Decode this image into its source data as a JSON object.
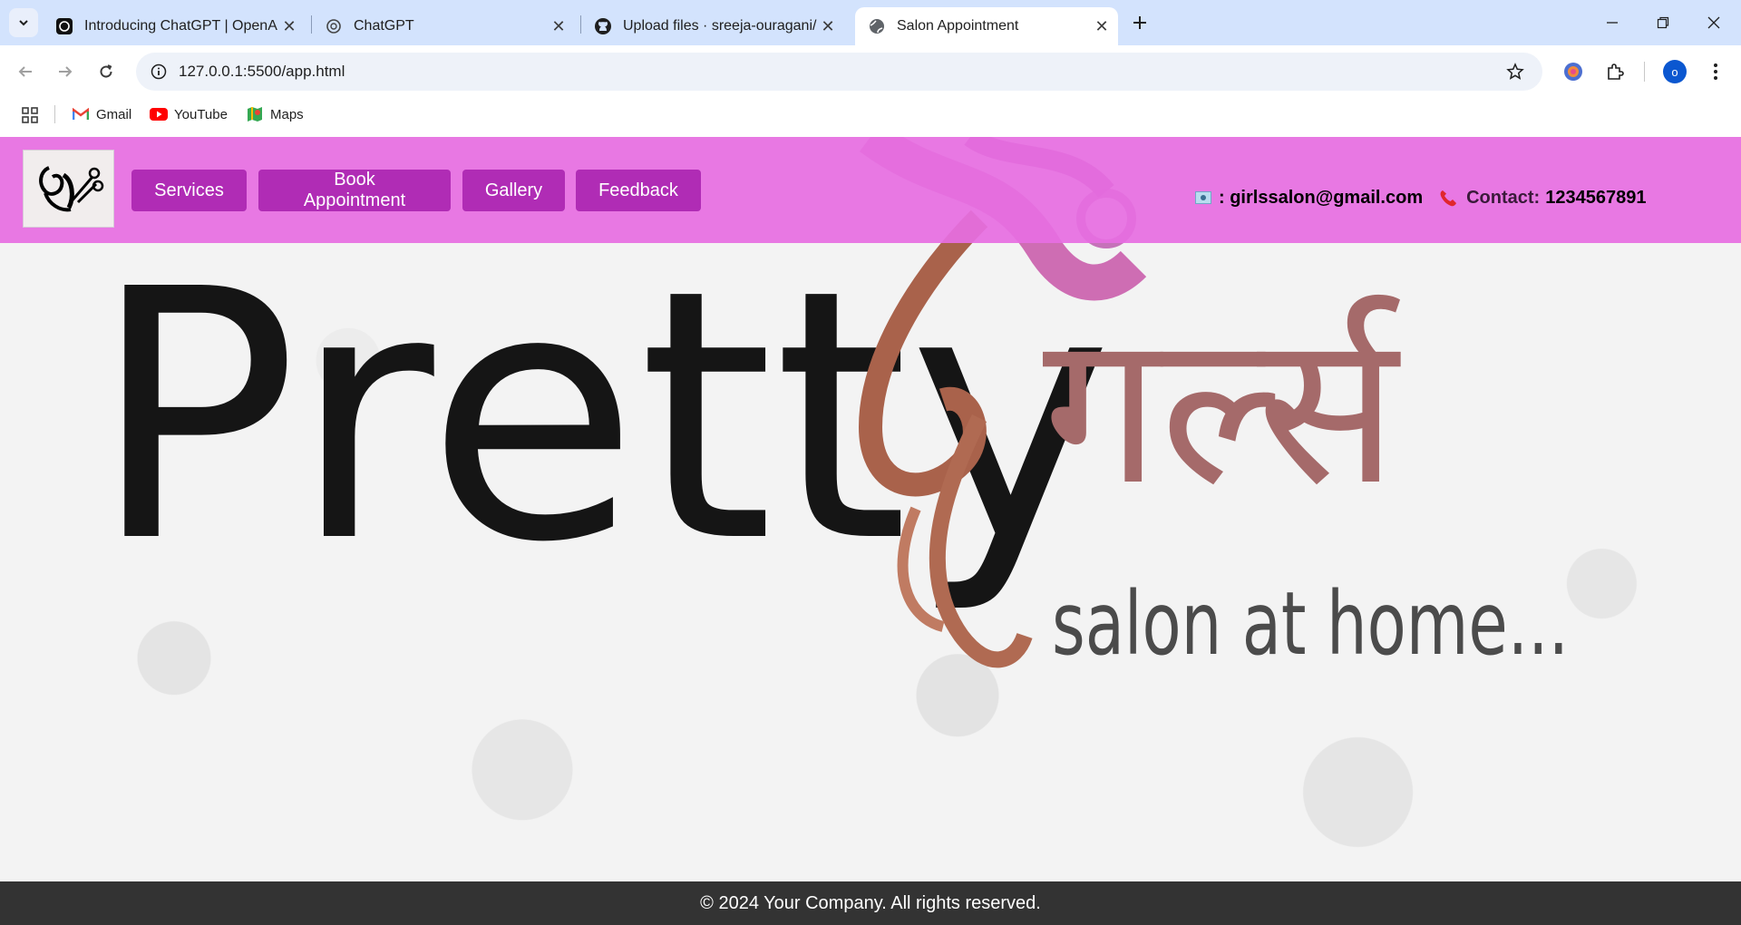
{
  "browser": {
    "tabs": [
      {
        "title": "Introducing ChatGPT | OpenAI",
        "favicon": "openai-icon",
        "active": false
      },
      {
        "title": "ChatGPT",
        "favicon": "openai-icon",
        "active": false
      },
      {
        "title": "Upload files · sreeja-ouragani/g",
        "favicon": "github-icon",
        "active": false
      },
      {
        "title": "Salon Appointment",
        "favicon": "globe-icon",
        "active": true
      }
    ],
    "url": "127.0.0.1:5500/app.html",
    "profile_initial": "o",
    "bookmarks": [
      {
        "label": "Gmail",
        "icon": "gmail-icon"
      },
      {
        "label": "YouTube",
        "icon": "youtube-icon"
      },
      {
        "label": "Maps",
        "icon": "maps-icon"
      }
    ]
  },
  "site": {
    "nav": {
      "services": "Services",
      "book": "Book Appointment",
      "gallery": "Gallery",
      "feedback": "Feedback"
    },
    "contact": {
      "email_prefix": ": girlssalon@gmail.com",
      "phone_label": "Contact:",
      "phone_number": "1234567891"
    },
    "hero": {
      "brand_latin": "Pretty",
      "brand_devanagari": "गर्ल्स",
      "tagline": "salon at home..."
    },
    "footer": "© 2024 Your Company. All rights reserved."
  },
  "colors": {
    "header_pink": "#e66ee1",
    "nav_button": "#b02cb5",
    "footer": "#333333",
    "tabstrip": "#d3e3fd"
  }
}
